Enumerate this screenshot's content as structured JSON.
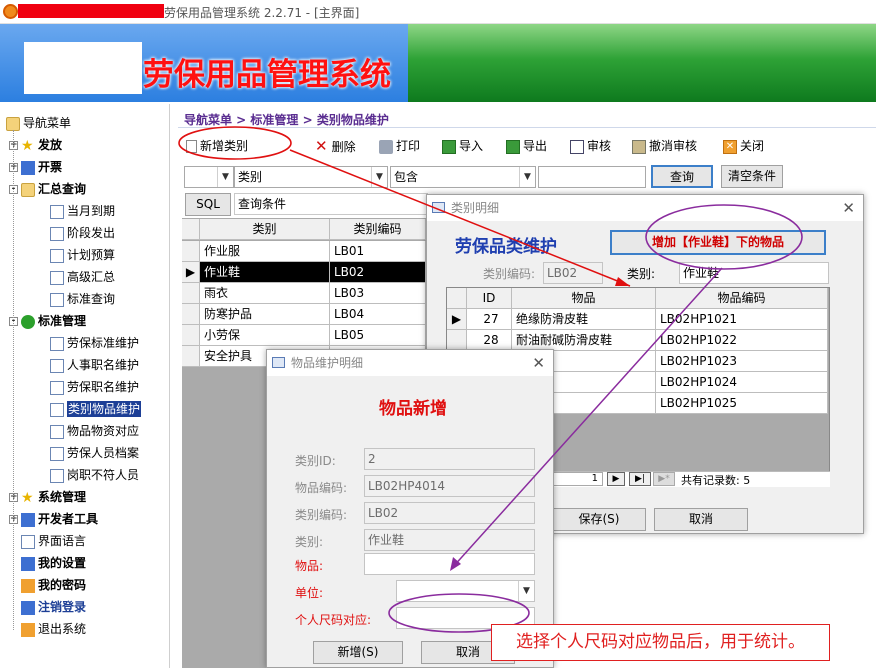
{
  "window": {
    "title": "劳保用品管理系统 2.2.71 - [主界面]"
  },
  "banner": {
    "title": "劳保用品管理系统"
  },
  "nav": {
    "root": "导航菜单",
    "items": [
      {
        "label": "发放",
        "level": 0,
        "bold": true,
        "expand": "+",
        "icon": "star-icon"
      },
      {
        "label": "开票",
        "level": 0,
        "bold": true,
        "expand": "+",
        "icon": "book-icon"
      },
      {
        "label": "汇总查询",
        "level": 0,
        "bold": true,
        "expand": "-",
        "icon": "folder-icon"
      },
      {
        "label": "当月到期",
        "level": 1,
        "icon": "grid-icon"
      },
      {
        "label": "阶段发出",
        "level": 1,
        "icon": "chart-icon"
      },
      {
        "label": "计划预算",
        "level": 1,
        "icon": "table-icon"
      },
      {
        "label": "高级汇总",
        "level": 1,
        "icon": "doc-icon"
      },
      {
        "label": "标准查询",
        "level": 1,
        "icon": "doc-icon"
      },
      {
        "label": "标准管理",
        "level": 0,
        "bold": true,
        "expand": "-",
        "icon": "circle-icon"
      },
      {
        "label": "劳保标准维护",
        "level": 1,
        "icon": "doc-icon"
      },
      {
        "label": "人事职名维护",
        "level": 1,
        "icon": "doc-icon"
      },
      {
        "label": "劳保职名维护",
        "level": 1,
        "icon": "doc-icon"
      },
      {
        "label": "类别物品维护",
        "level": 1,
        "icon": "doc-icon",
        "selected": true
      },
      {
        "label": "物品物资对应",
        "level": 1,
        "icon": "doc-icon"
      },
      {
        "label": "劳保人员档案",
        "level": 1,
        "icon": "doc-icon"
      },
      {
        "label": "岗职不符人员",
        "level": 1,
        "icon": "doc-icon"
      },
      {
        "label": "系统管理",
        "level": 0,
        "bold": true,
        "expand": "+",
        "icon": "star-icon"
      },
      {
        "label": "开发者工具",
        "level": 0,
        "bold": true,
        "expand": "+",
        "icon": "wrench-icon"
      },
      {
        "label": "界面语言",
        "level": 0,
        "icon": "lang-icon"
      },
      {
        "label": "我的设置",
        "level": 0,
        "bold": true,
        "icon": "settings-icon"
      },
      {
        "label": "我的密码",
        "level": 0,
        "bold": true,
        "icon": "user-icon"
      },
      {
        "label": "注销登录",
        "level": 0,
        "bold": true,
        "blue": true,
        "icon": "logout-icon"
      },
      {
        "label": "退出系统",
        "level": 0,
        "icon": "exit-icon"
      }
    ]
  },
  "breadcrumb": "导航菜单 > 标准管理 > 类别物品维护",
  "toolbar": {
    "add": "新增类别",
    "delete": "删除",
    "print": "打印",
    "import": "导入",
    "export": "导出",
    "audit": "审核",
    "unaudit": "撤消审核",
    "close": "关闭"
  },
  "filter": {
    "field": "类别",
    "op": "包含",
    "query": "查询",
    "clear": "清空条件",
    "sql": "SQL",
    "cond_label": "查询条件"
  },
  "grid": {
    "headers": [
      "类别",
      "类别编码"
    ],
    "rows": [
      [
        "作业服",
        "LB01"
      ],
      [
        "作业鞋",
        "LB02"
      ],
      [
        "雨衣",
        "LB03"
      ],
      [
        "防寒护品",
        "LB04"
      ],
      [
        "小劳保",
        "LB05"
      ],
      [
        "安全护具",
        ""
      ]
    ],
    "selected": 1
  },
  "dialog1": {
    "title": "类别明细",
    "heading": "劳保品类维护",
    "add_btn": "增加【作业鞋】下的物品",
    "code_label": "类别编码:",
    "code_value": "LB02",
    "cat_label": "类别:",
    "cat_value": "作业鞋",
    "headers": [
      "ID",
      "物品",
      "物品编码"
    ],
    "rows": [
      [
        "27",
        "绝缘防滑皮鞋",
        "LB02HP1021"
      ],
      [
        "28",
        "耐油耐碱防滑皮鞋",
        "LB02HP1022"
      ],
      [
        "",
        "业鞋",
        "LB02HP1023"
      ],
      [
        "",
        "皮鞋",
        "LB02HP1024"
      ],
      [
        "",
        "",
        "LB02HP1025"
      ]
    ],
    "page": "1",
    "records": "共有记录数: 5",
    "save": "保存(S)",
    "cancel": "取消"
  },
  "dialog2": {
    "title": "物品维护明细",
    "heading": "物品新增",
    "fields": [
      {
        "label": "类别ID:",
        "value": "2"
      },
      {
        "label": "物品编码:",
        "value": "LB02HP4014"
      },
      {
        "label": "类别编码:",
        "value": "LB02"
      },
      {
        "label": "类别:",
        "value": "作业鞋"
      }
    ],
    "item_label": "物品:",
    "unit_label": "单位:",
    "size_label": "个人尺码对应:",
    "add": "新增(S)",
    "cancel": "取消"
  },
  "annotation": "选择个人尺码对应物品后，用于统计。",
  "colors": {
    "accent_purple": "#5a2d91",
    "red": "#e02020",
    "select_blue": "#1d3f96",
    "arrow_purple": "#8a2c9e",
    "arrow_red": "#e01010"
  }
}
